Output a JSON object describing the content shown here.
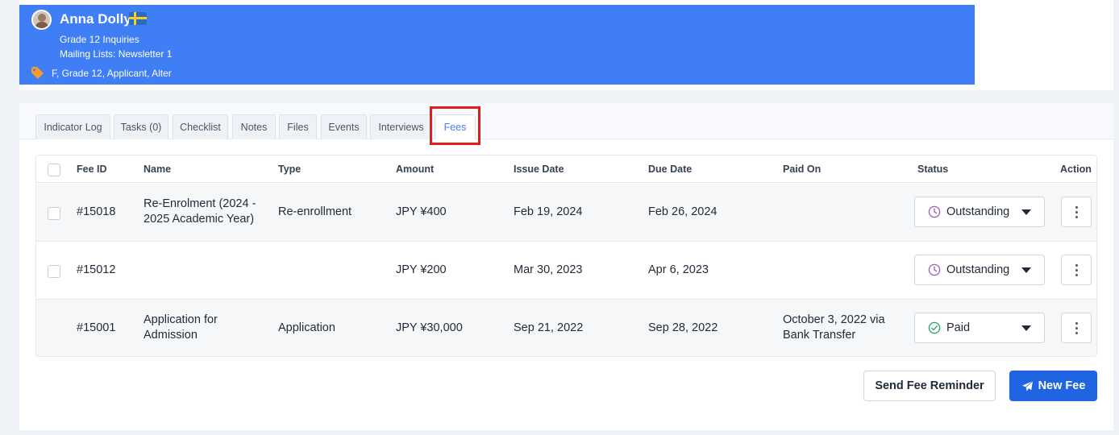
{
  "profile": {
    "name": "Anna Dolly",
    "program": "Grade 12 Inquiries",
    "mailing_lists": "Mailing Lists: Newsletter 1",
    "tags": "F, Grade 12, Applicant, Alter"
  },
  "tabs": [
    {
      "label": "Indicator Log"
    },
    {
      "label": "Tasks (0)"
    },
    {
      "label": "Checklist"
    },
    {
      "label": "Notes"
    },
    {
      "label": "Files"
    },
    {
      "label": "Events"
    },
    {
      "label": "Interviews"
    },
    {
      "label": "Fees",
      "active": true
    }
  ],
  "table": {
    "columns": [
      "Fee ID",
      "Name",
      "Type",
      "Amount",
      "Issue Date",
      "Due Date",
      "Paid On",
      "Status",
      "Action"
    ],
    "rows": [
      {
        "fee_id": "#15018",
        "name": "Re-Enrolment (2024 - 2025 Academic Year)",
        "type": "Re-enrollment",
        "amount": "JPY ¥400",
        "issue_date": "Feb 19, 2024",
        "due_date": "Feb 26, 2024",
        "paid_on": "",
        "status": "Outstanding"
      },
      {
        "fee_id": "#15012",
        "name": "",
        "type": "",
        "amount": "JPY ¥200",
        "issue_date": "Mar 30, 2023",
        "due_date": "Apr 6, 2023",
        "paid_on": "",
        "status": "Outstanding"
      },
      {
        "fee_id": "#15001",
        "name": "Application for Admission",
        "type": "Application",
        "amount": "JPY ¥30,000",
        "issue_date": "Sep 21, 2022",
        "due_date": "Sep 28, 2022",
        "paid_on": "October 3, 2022 via Bank Transfer",
        "status": "Paid"
      }
    ]
  },
  "buttons": {
    "send_reminder": "Send Fee Reminder",
    "new_fee": "New Fee"
  },
  "colors": {
    "banner": "#3f7ef5",
    "primary_button": "#1f64e0",
    "highlight": "#e21b1b",
    "outstanding_icon": "#9b59b6",
    "paid_icon": "#22a06b",
    "tag_icon": "#f39c2b"
  },
  "icons": {
    "tag": "tag-icon",
    "outstanding": "clock-icon",
    "paid": "check-circle-icon",
    "action": "more-vertical-icon",
    "new_fee": "paper-plane-icon"
  }
}
